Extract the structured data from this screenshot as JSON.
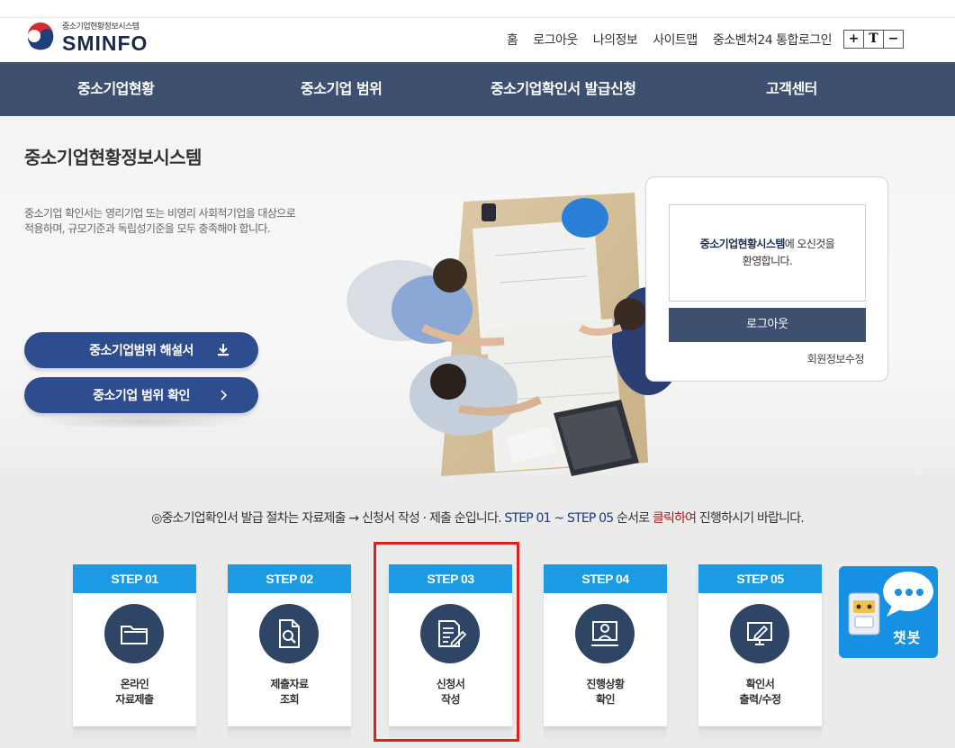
{
  "header": {
    "logo_sub": "중소기업현황정보시스템",
    "logo_main": "SMINFO",
    "util_links": [
      "홈",
      "로그아웃",
      "나의정보",
      "사이트맵",
      "중소벤처24 통합로그인"
    ],
    "font_controls": [
      "+",
      "T",
      "−"
    ]
  },
  "gnb": {
    "items": [
      "중소기업현황",
      "중소기업 범위",
      "중소기업확인서 발급신청",
      "고객센터"
    ]
  },
  "hero": {
    "title": "중소기업현황정보시스템",
    "description": "중소기업 확인서는 영리기업 또는 비영리 사회적기업을 대상으로 적용하며, 규모기준과 독립성기준을 모두 충족해야 합니다.",
    "buttons": [
      "중소기업범위 해설서",
      "중소기업 범위 확인"
    ]
  },
  "login": {
    "welcome_bold": "중소기업현황시스템",
    "welcome_rest": "에 오신것을",
    "welcome_line2": "환영합니다.",
    "logout_label": "로그아웃",
    "edit_label": "회원정보수정"
  },
  "notice": {
    "part1": "◎중소기업확인서 발급 절차는 자료제출 → 신청서 작성 · 제출 순입니다. ",
    "part2": "STEP 01 ~ STEP 05",
    "part3": " 순서로 ",
    "part4": "클릭하여",
    "part5": " 진행하시기 바랍니다."
  },
  "steps": [
    {
      "head": "STEP 01",
      "label": "온라인\n자료제출",
      "icon": "folder-icon"
    },
    {
      "head": "STEP 02",
      "label": "제출자료\n조회",
      "icon": "document-search-icon"
    },
    {
      "head": "STEP 03",
      "label": "신청서\n작성",
      "icon": "document-edit-icon"
    },
    {
      "head": "STEP 04",
      "label": "진행상황\n확인",
      "icon": "monitor-user-icon"
    },
    {
      "head": "STEP 05",
      "label": "확인서\n출력/수정",
      "icon": "monitor-edit-icon"
    }
  ],
  "chatbot": {
    "label": "챗봇"
  },
  "colors": {
    "gnb": "#3d506f",
    "pill": "#2e4d8e",
    "step_head": "#1a9be3",
    "step_circle": "#2f4566",
    "highlight": "#e0201e",
    "chatbot": "#1590e3"
  }
}
